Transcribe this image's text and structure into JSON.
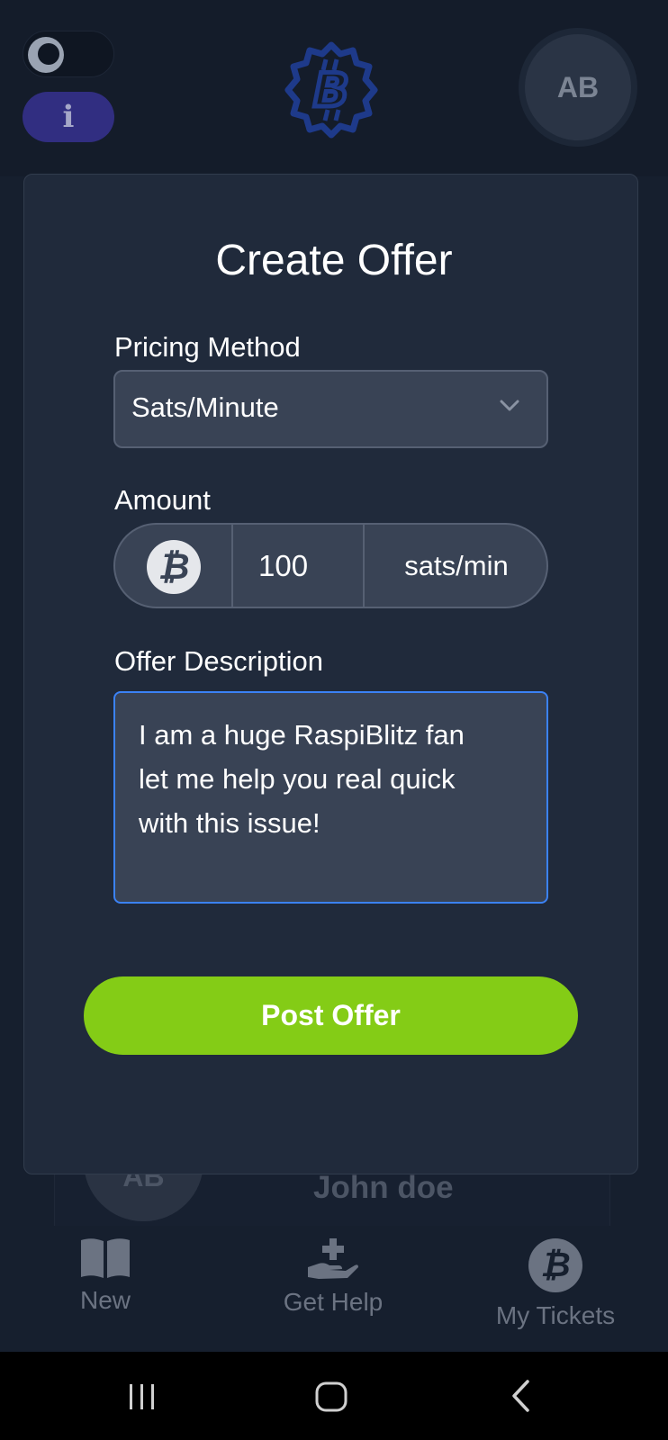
{
  "header": {
    "info_label": "i",
    "avatar_initials": "AB"
  },
  "modal": {
    "title": "Create Offer",
    "pricing_method": {
      "label": "Pricing Method",
      "selected": "Sats/Minute"
    },
    "amount": {
      "label": "Amount",
      "currency_symbol": "₿",
      "value": "100",
      "unit": "sats/min"
    },
    "description": {
      "label": "Offer Description",
      "value": "I am a huge RaspiBlitz fan\nlet me help you real quick\nwith this issue!"
    },
    "submit_label": "Post Offer"
  },
  "background_list": {
    "avatar_initials": "AB",
    "name": "John doe"
  },
  "bottom_nav": {
    "items": [
      {
        "label": "New",
        "icon": "book-icon"
      },
      {
        "label": "Get Help",
        "icon": "hand-plus-icon"
      },
      {
        "label": "My Tickets",
        "icon": "bitcoin-icon"
      }
    ]
  },
  "colors": {
    "accent_green": "#84cc16",
    "focus_blue": "#3b82f6",
    "info_purple": "#312e81",
    "logo_blue": "#1e3a8a"
  }
}
